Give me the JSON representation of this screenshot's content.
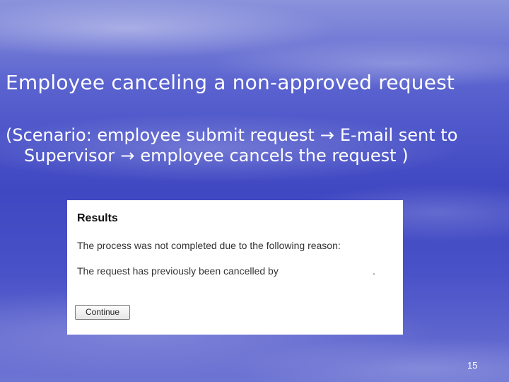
{
  "slide": {
    "title": "Employee canceling a non-approved request",
    "scenario": {
      "line1_prefix": "(Scenario:  employee submit request",
      "arrow1": "→",
      "line1_suffix": "E-mail sent to",
      "line2_prefix": "Supervisor",
      "arrow2": "→",
      "line2_suffix": "employee cancels the request )"
    },
    "page_number": "15"
  },
  "results_panel": {
    "heading": "Results",
    "message": "The process was not completed due to the following reason:",
    "reason": "The request has previously been cancelled by",
    "reason_end": ".",
    "continue_label": "Continue"
  }
}
